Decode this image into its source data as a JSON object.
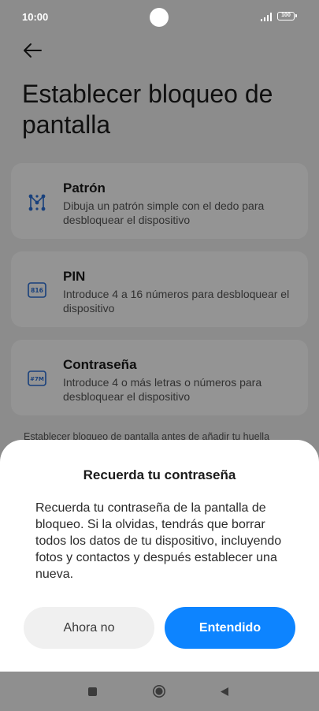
{
  "status_bar": {
    "time": "10:00",
    "battery": "100"
  },
  "page": {
    "title": "Establecer bloqueo de pantalla"
  },
  "options": [
    {
      "title": "Patrón",
      "description": "Dibuja un patrón simple con el dedo para desbloquear el dispositivo",
      "icon": "pattern-icon",
      "icon_text": ""
    },
    {
      "title": "PIN",
      "description": "Introduce 4 a 16 números para desbloquear el dispositivo",
      "icon": "pin-icon",
      "icon_text": "816"
    },
    {
      "title": "Contraseña",
      "description": "Introduce 4 o más letras o números para desbloquear el dispositivo",
      "icon": "password-icon",
      "icon_text": "#7M"
    }
  ],
  "fingerprint_note": "Establecer bloqueo de pantalla antes de añadir tu huella",
  "dialog": {
    "title": "Recuerda tu contraseña",
    "message": "Recuerda tu contraseña de la pantalla de bloqueo. Si la olvidas, tendrás que borrar todos los datos de tu dispositivo, incluyendo fotos y contactos y después establecer una nueva.",
    "secondary_label": "Ahora no",
    "primary_label": "Entendido"
  },
  "colors": {
    "accent": "#0d84ff",
    "icon_blue": "#2a6fd6"
  }
}
